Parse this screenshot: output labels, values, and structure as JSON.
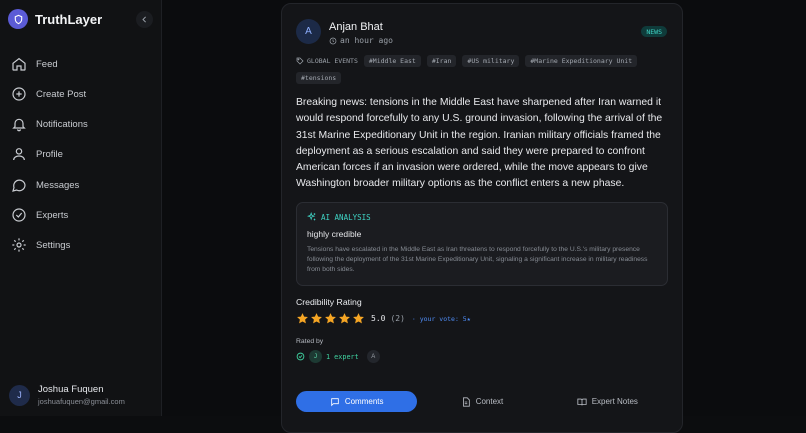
{
  "app": {
    "name": "TruthLayer"
  },
  "nav": {
    "items": [
      {
        "label": "Feed"
      },
      {
        "label": "Create Post"
      },
      {
        "label": "Notifications"
      },
      {
        "label": "Profile"
      },
      {
        "label": "Messages"
      },
      {
        "label": "Experts"
      },
      {
        "label": "Settings"
      }
    ]
  },
  "user": {
    "initial": "J",
    "name": "Joshua Fuquen",
    "email": "joshuafuquen@gmail.com"
  },
  "post": {
    "author_initial": "A",
    "author": "Anjan Bhat",
    "time": "an hour ago",
    "badge": "NEWS",
    "category": "GLOBAL EVENTS",
    "tags": [
      "#Middle East",
      "#Iran",
      "#US military",
      "#Marine Expeditionary Unit",
      "#tensions"
    ],
    "body": "Breaking news: tensions in the Middle East have sharpened after Iran warned it would respond forcefully to any U.S. ground invasion, following the arrival of the 31st Marine Expeditionary Unit in the region. Iranian military officials framed the deployment as a serious escalation and said they were prepared to confront American forces if an invasion were ordered, while the move appears to give Washington broader military options as the conflict enters a new phase."
  },
  "ai": {
    "heading": "AI ANALYSIS",
    "verdict": "highly credible",
    "summary": "Tensions have escalated in the Middle East as Iran threatens to respond forcefully to the U.S.'s military presence following the deployment of the 31st Marine Expeditionary Unit, signaling a significant increase in military readiness from both sides."
  },
  "credibility": {
    "title": "Credibility Rating",
    "stars_filled": 5,
    "stars_total": 5,
    "score": "5.0",
    "count": "(2)",
    "your_vote": "· your vote: 5★",
    "rated_by": "Rated by",
    "expert_initial": "J",
    "expert_count": "1 expert",
    "other_initial": "A"
  },
  "tabs": [
    {
      "label": "Comments",
      "active": true
    },
    {
      "label": "Context",
      "active": false
    },
    {
      "label": "Expert Notes",
      "active": false
    }
  ],
  "colors": {
    "accent": "#2f6fe6",
    "teal": "#3fd3c4",
    "star": "#f5a524",
    "brand": "#5b5bd6"
  }
}
